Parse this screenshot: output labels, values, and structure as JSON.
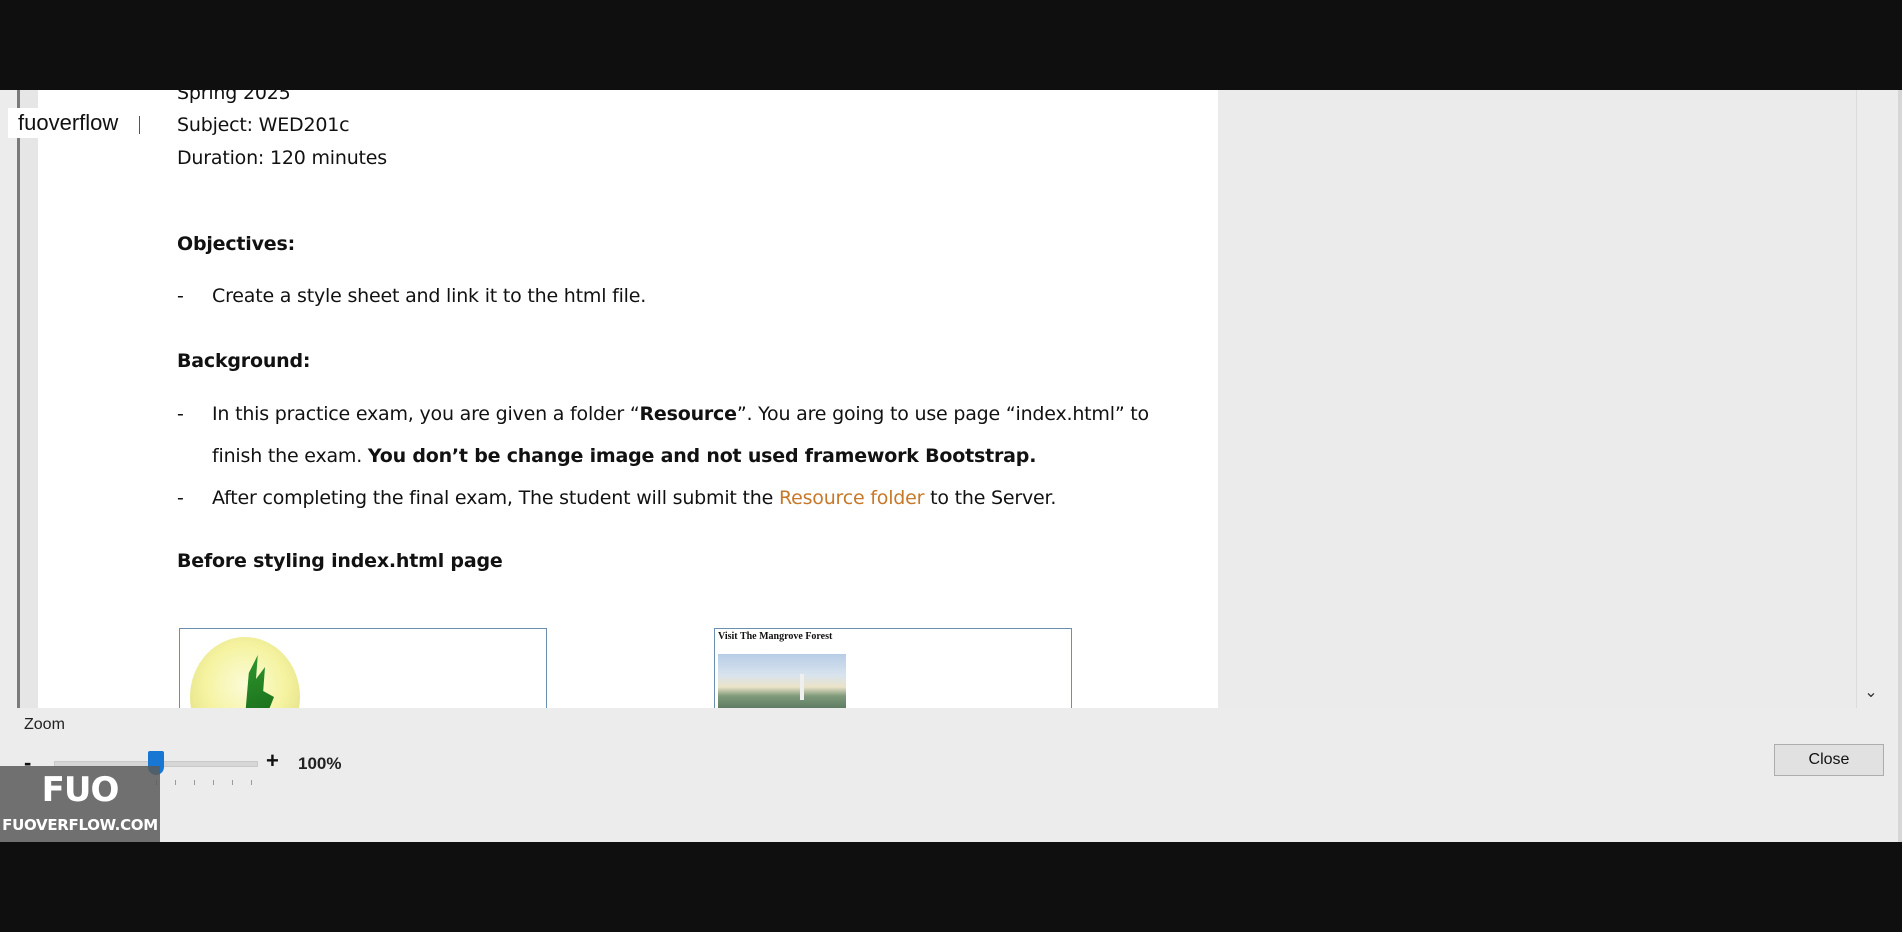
{
  "document": {
    "term": "Spring 2025",
    "subject": "Subject: WED201c",
    "duration": "Duration: 120 minutes",
    "objectives_heading": "Objectives:",
    "objective_1": "Create a style sheet and link it to the html file.",
    "background_heading": "Background:",
    "bullet_dash": "-",
    "bg1_part1": "In this practice exam, you are given a folder “",
    "bg1_bold": "Resource",
    "bg1_part2": "”. You are going to use page “index.html”  to",
    "bg1_line2_plain": "finish the exam. ",
    "bg1_line2_bold": "You don’t be change image and not used framework Bootstrap.",
    "bg2_part1": "After completing the final exam, The student will submit the ",
    "bg2_highlight": "Resource folder",
    "bg2_part2": " to the Server.",
    "before_heading": "Before styling index.html page",
    "preview_right_title": "Visit The Mangrove Forest"
  },
  "overlay": {
    "label": "fuoverflow"
  },
  "zoom": {
    "label": "Zoom",
    "minus": "-",
    "plus": "+",
    "value": "100%",
    "slider_value": 0.45
  },
  "buttons": {
    "close_label": "Close"
  },
  "watermark": {
    "logo_text": "FUO",
    "site": "FUOVERFLOW.COM"
  },
  "icons": {
    "scroll_down": "chevron-down-icon"
  },
  "colors": {
    "highlight_orange": "#c77828",
    "slider_thumb": "#1877d2",
    "page_background": "#ffffff",
    "panel_background": "#ececec"
  }
}
